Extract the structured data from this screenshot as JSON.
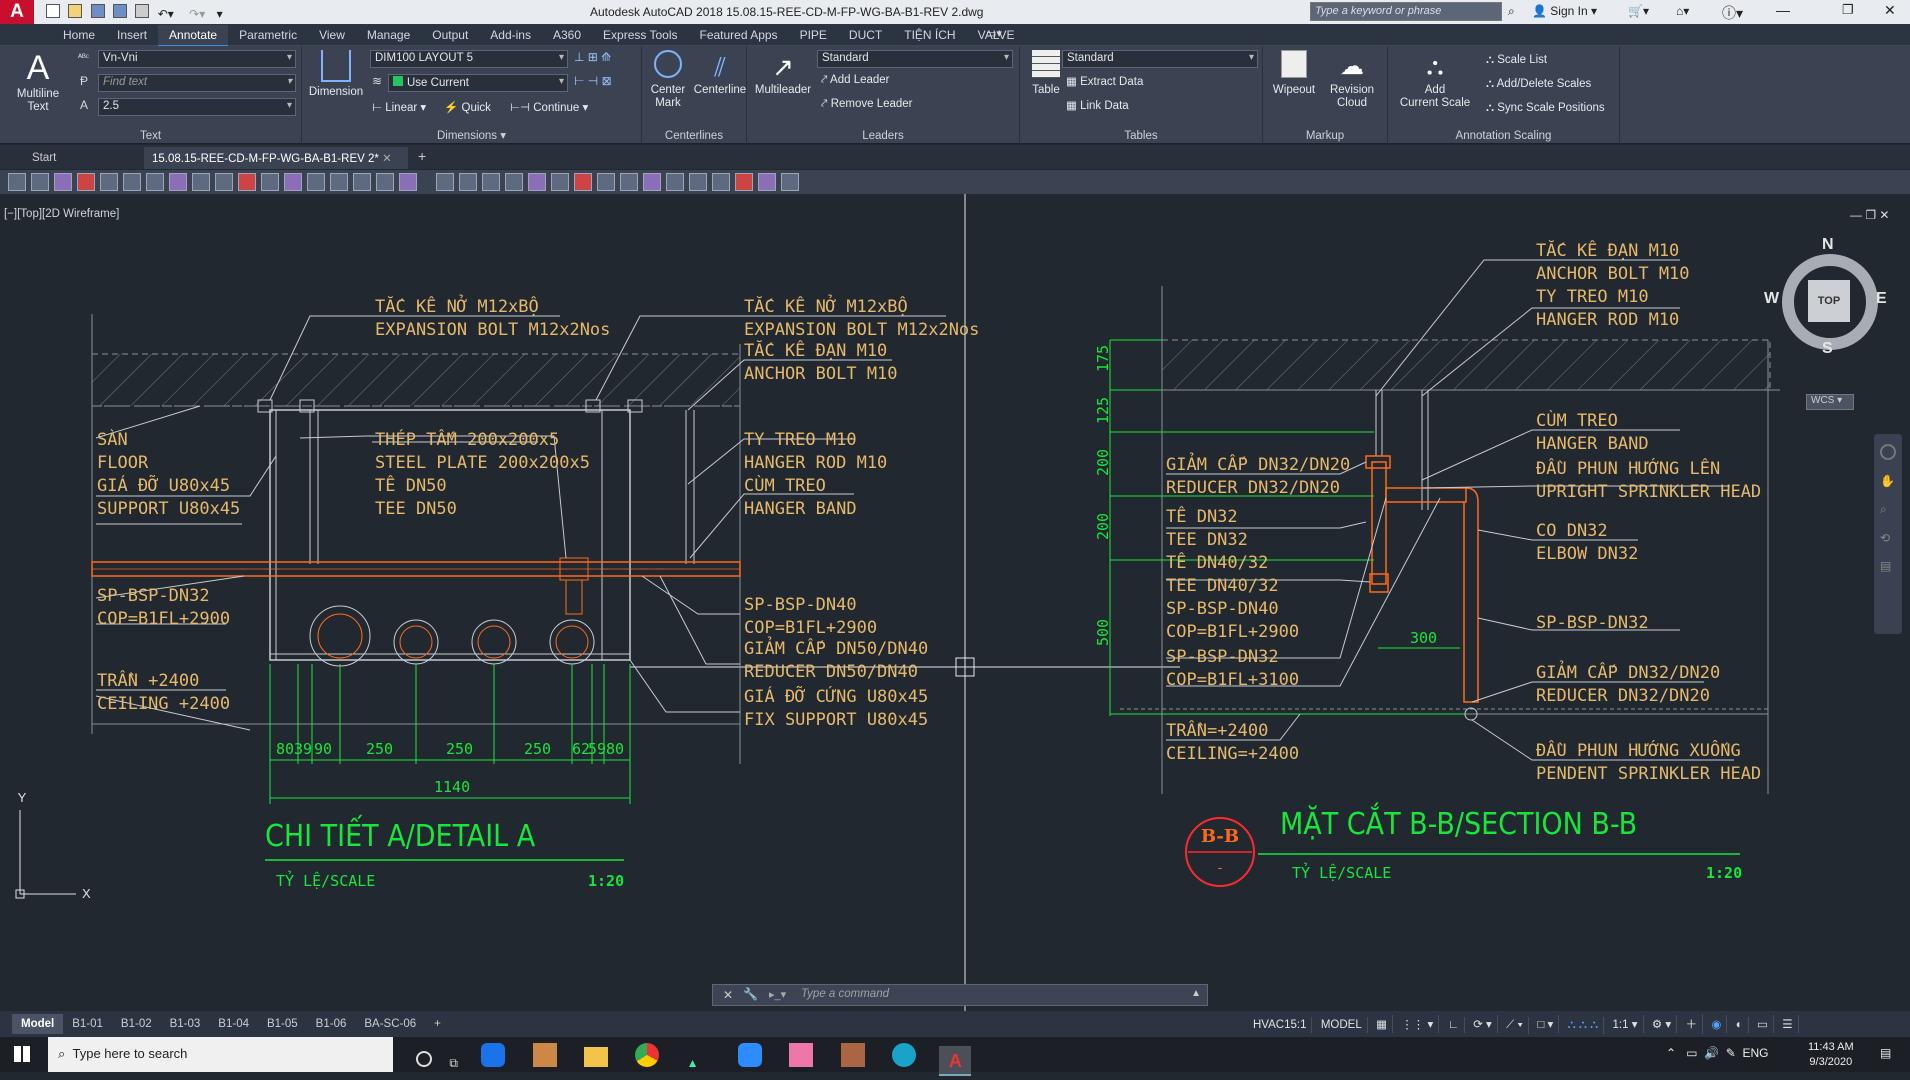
{
  "window": {
    "title": "Autodesk AutoCAD 2018   15.08.15-REE-CD-M-FP-WG-BA-B1-REV 2.dwg",
    "search_placeholder": "Type a keyword or phrase",
    "signin": "Sign In"
  },
  "ribbon_tabs": [
    "Home",
    "Insert",
    "Annotate",
    "Parametric",
    "View",
    "Manage",
    "Output",
    "Add-ins",
    "A360",
    "Express Tools",
    "Featured Apps",
    "PIPE",
    "DUCT",
    "TIỆN ÍCH",
    "VALVE"
  ],
  "ribbon_active": "Annotate",
  "text_panel": {
    "multiline_label": "Multiline",
    "multiline_label2": "Text",
    "font": "Vn-Vni",
    "find_placeholder": "Find text",
    "height": "2.5",
    "title": "Text"
  },
  "dimensions_panel": {
    "dimension_label": "Dimension",
    "style": "DIM100 LAYOUT 5",
    "layer": "Use Current",
    "linear": "Linear",
    "quick": "Quick",
    "continue": "Continue",
    "title": "Dimensions"
  },
  "centerlines_panel": {
    "center_mark": "Center",
    "center_mark2": "Mark",
    "centerline": "Centerline",
    "title": "Centerlines"
  },
  "leaders_panel": {
    "multileader": "Multileader",
    "style": "Standard",
    "add": "Add Leader",
    "remove": "Remove Leader",
    "title": "Leaders"
  },
  "tables_panel": {
    "table": "Table",
    "style": "Standard",
    "extract": "Extract Data",
    "link": "Link Data",
    "title": "Tables"
  },
  "markup_panel": {
    "wipeout": "Wipeout",
    "revision": "Revision",
    "revision2": "Cloud",
    "title": "Markup"
  },
  "scaling_panel": {
    "add": "Add",
    "add2": "Current Scale",
    "scale_list": "Scale List",
    "add_delete": "Add/Delete Scales",
    "sync": "Sync Scale Positions",
    "title": "Annotation Scaling"
  },
  "doc_tabs": [
    "Start",
    "15.08.15-REE-CD-M-FP-WG-BA-B1-REV 2*"
  ],
  "viewport_label": "[−][Top][2D Wireframe]",
  "viewcube": {
    "n": "N",
    "s": "S",
    "e": "E",
    "w": "W",
    "top": "TOP",
    "wcs": "WCS"
  },
  "command_placeholder": "Type a command",
  "layout_tabs": [
    "Model",
    "B1-01",
    "B1-02",
    "B1-03",
    "B1-04",
    "B1-05",
    "B1-06",
    "BA-SC-06"
  ],
  "status": {
    "scale_name": "HVAC15:1",
    "model": "MODEL",
    "anno": "1:1"
  },
  "taskbar": {
    "search": "Type here to search",
    "time": "11:43 AM",
    "date": "9/3/2020",
    "lang": "ENG"
  },
  "drawing": {
    "detail_a": {
      "title": "CHI TIẾT A/DETAIL A",
      "scale_label": "TỶ LỆ/SCALE",
      "scale": "1:20",
      "labels": [
        "TẮC KÊ NỞ M12xBỘ",
        "EXPANSION BOLT M12x2Nos",
        "TẮC KÊ NỞ M12xBỘ",
        "EXPANSION BOLT M12x2Nos",
        "TẮC KÊ ĐẠN M10",
        "ANCHOR BOLT M10",
        "SÀN",
        "FLOOR",
        "GIÁ ĐỠ U80x45",
        "SUPPORT U80x45",
        "THÉP TẤM 200x200x5",
        "STEEL PLATE 200x200x5",
        "TÊ DN50",
        "TEE DN50",
        "TY TREO M10",
        "HANGER ROD M10",
        "CÙM TREO",
        "HANGER BAND",
        "SP-BSP-DN32",
        "COP=B1FL+2900",
        "SP-BSP-DN40",
        "COP=B1FL+2900",
        "GIẢM CẤP DN50/DN40",
        "REDUCER DN50/DN40",
        "TRẦN +2400",
        "CEILING +2400",
        "GIÁ ĐỠ CỨNG U80x45",
        "FIX SUPPORT U80x45"
      ],
      "dims": [
        "80",
        "39",
        "90",
        "250",
        "250",
        "250",
        "62",
        "59",
        "80",
        "1140"
      ]
    },
    "section_bb": {
      "title": "MẶT CẮT B-B/SECTION B-B",
      "tag": "B-B",
      "tag_sub": "-",
      "scale_label": "TỶ LỆ/SCALE",
      "scale": "1:20",
      "labels": [
        "TẮC KÊ ĐẠN M10",
        "ANCHOR BOLT M10",
        "TY TREO M10",
        "HANGER ROD M10",
        "CÙM TREO",
        "HANGER BAND",
        "ĐẦU PHUN HƯỚNG LÊN",
        "UPRIGHT SPRINKLER HEAD",
        "CO DN32",
        "ELBOW DN32",
        "SP-BSP-DN32",
        "GIẢM CẤP DN32/DN20",
        "REDUCER DN32/DN20",
        "ĐẦU PHUN HƯỚNG XUỐNG",
        "PENDENT SPRINKLER HEAD",
        "GIẢM CẤP DN32/DN20",
        "REDUCER DN32/DN20",
        "TÊ DN32",
        "TEE DN32",
        "TÊ DN40/32",
        "TEE DN40/32",
        "SP-BSP-DN40",
        "COP=B1FL+2900",
        "SP-BSP-DN32",
        "COP=B1FL+3100",
        "TRẦN=+2400",
        "CEILING=+2400"
      ],
      "dims": [
        "175",
        "125",
        "200",
        "200",
        "500",
        "300"
      ]
    }
  },
  "colors": {
    "annotation": "#e6b86a",
    "dim": "#19e63a",
    "pipe": "#ff6a1a",
    "bg": "#212830"
  }
}
